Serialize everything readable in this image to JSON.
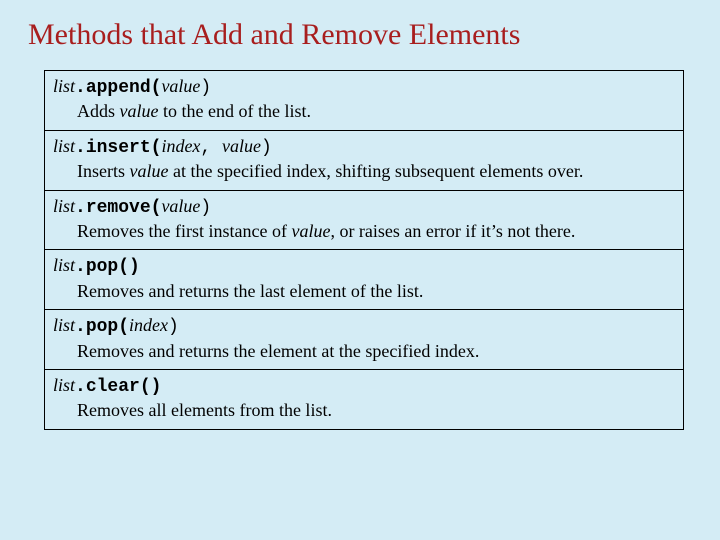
{
  "title": "Methods that Add and Remove Elements",
  "rows": [
    {
      "obj": "list",
      "dot_method": ".append(",
      "params": "value",
      "close": ")",
      "desc_pre": "Adds ",
      "desc_it": "value",
      "desc_post": " to the end of the list."
    },
    {
      "obj": "list",
      "dot_method": ".insert(",
      "params": "index",
      "mid": ", ",
      "params2": "value",
      "close": ")",
      "desc_pre": "Inserts ",
      "desc_it": "value",
      "desc_post": " at the specified index, shifting subsequent elements over."
    },
    {
      "obj": "list",
      "dot_method": ".remove(",
      "params": "value",
      "close": ")",
      "desc_pre": "Removes the first instance of ",
      "desc_it": "value",
      "desc_post": ", or raises an error if it’s not there."
    },
    {
      "obj": "list",
      "dot_method": ".pop()",
      "params": "",
      "close": "",
      "desc_pre": "Removes and returns the last element of the list.",
      "desc_it": "",
      "desc_post": ""
    },
    {
      "obj": "list",
      "dot_method": ".pop(",
      "params": "index",
      "close": ")",
      "desc_pre": "Removes and returns the element at the specified index.",
      "desc_it": "",
      "desc_post": ""
    },
    {
      "obj": "list",
      "dot_method": ".clear()",
      "params": "",
      "close": "",
      "desc_pre": "Removes all elements from the list.",
      "desc_it": "",
      "desc_post": ""
    }
  ]
}
